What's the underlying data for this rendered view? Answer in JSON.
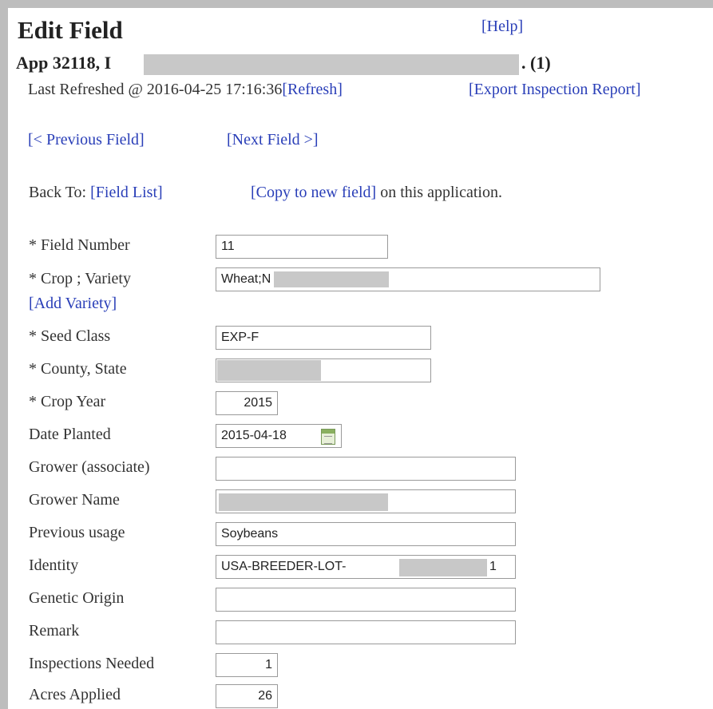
{
  "header": {
    "title": "Edit Field",
    "help_link": "[Help]",
    "app_prefix": "App 32118, I",
    "app_suffix": ". (1)",
    "last_refreshed": "Last Refreshed @ 2016-04-25 17:16:36",
    "refresh_link": "[Refresh]",
    "export_link": "[Export Inspection Report]"
  },
  "navigation": {
    "previous_field": "[< Previous Field]",
    "next_field": "[Next Field >]",
    "back_to": "Back To:",
    "field_list": "[Field List]",
    "copy_to_new": "[Copy to new field]",
    "copy_suffix": " on this application."
  },
  "form": {
    "field_number": {
      "label": "* Field Number",
      "value": "11"
    },
    "crop_variety": {
      "label": "* Crop ; Variety",
      "value": "Wheat;N"
    },
    "add_variety": "[Add Variety]",
    "seed_class": {
      "label": "* Seed Class",
      "value": "EXP-F"
    },
    "county_state": {
      "label": "* County, State",
      "value": ""
    },
    "crop_year": {
      "label": "* Crop Year",
      "value": "2015"
    },
    "date_planted": {
      "label": "Date Planted",
      "value": "2015-04-18"
    },
    "grower_associate": {
      "label": "Grower (associate)",
      "value": ""
    },
    "grower_name": {
      "label": "Grower Name",
      "value": ""
    },
    "previous_usage": {
      "label": "Previous usage",
      "value": "Soybeans"
    },
    "identity": {
      "label": "Identity",
      "value_prefix": "USA-BREEDER-LOT-",
      "value_suffix": "1"
    },
    "genetic_origin": {
      "label": "Genetic Origin",
      "value": ""
    },
    "remark": {
      "label": "Remark",
      "value": ""
    },
    "inspections_needed": {
      "label": "Inspections Needed",
      "value": "1"
    },
    "acres_applied": {
      "label": "Acres Applied",
      "value": "26"
    }
  },
  "icons": {
    "calendar": "calendar-icon"
  },
  "colors": {
    "link": "#2a3fb8",
    "redaction": "#c8c8c8",
    "frame": "#bdbdbd"
  }
}
